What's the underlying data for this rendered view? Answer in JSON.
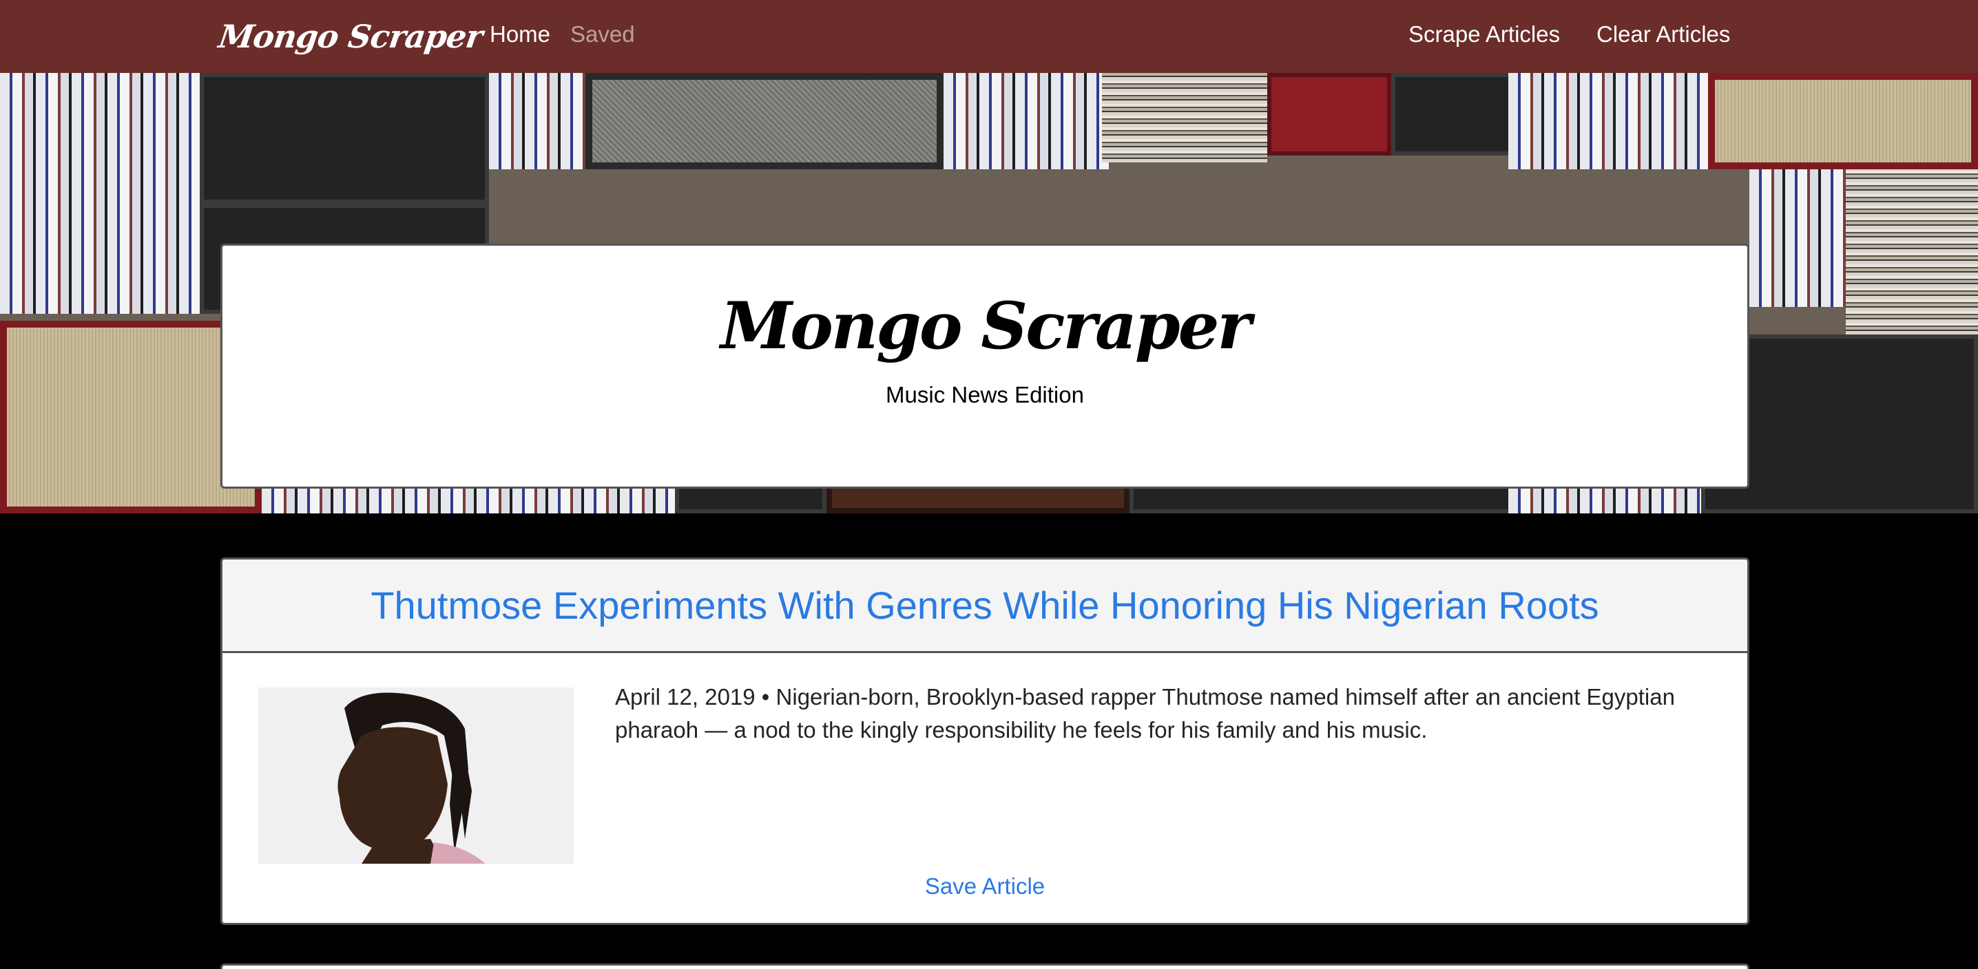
{
  "navbar": {
    "brand": "Mongo Scraper",
    "links": {
      "home": "Home",
      "saved": "Saved",
      "scrape": "Scrape Articles",
      "clear": "Clear Articles"
    },
    "background_color": "#6b2d29"
  },
  "jumbotron": {
    "title": "Mongo Scraper",
    "subtitle": "Music News Edition"
  },
  "articles": [
    {
      "title": "Thutmose Experiments With Genres While Honoring His Nigerian Roots",
      "summary": "April 12, 2019 • Nigerian-born, Brooklyn-based rapper Thutmose named himself after an ancient Egyptian pharaoh — a nod to the kingly responsibility he feels for his family and his music.",
      "save_label": "Save Article"
    }
  ],
  "colors": {
    "link": "#2a7ae2",
    "page_background": "#000000"
  }
}
